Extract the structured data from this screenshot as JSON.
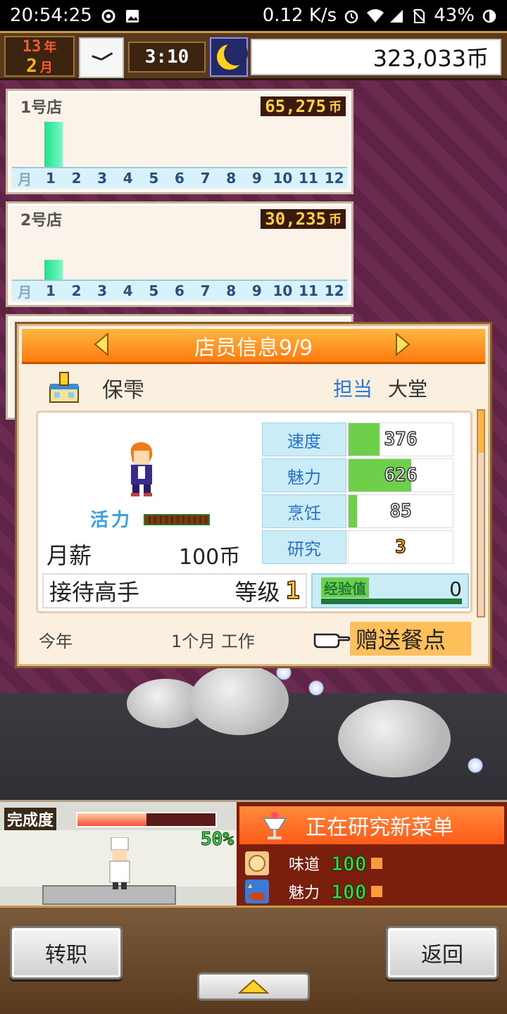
{
  "status_bar": {
    "time": "20:54:25",
    "network_speed": "0.12 K/s",
    "battery": "43%",
    "icons": [
      "swirl-icon",
      "image-icon",
      "alarm-icon",
      "wifi-icon",
      "signal-icon",
      "no-sim-icon",
      "battery-icon"
    ]
  },
  "hud": {
    "year_num": "13",
    "year_unit": "年",
    "month_num": "2",
    "month_unit": "月",
    "time": "3:10",
    "money": "323,033币"
  },
  "stores": [
    {
      "name": "1号店",
      "amount": "65,275",
      "currency_icon": "币",
      "bar_month": 1,
      "bar_fraction": 0.85
    },
    {
      "name": "2号店",
      "amount": "30,235",
      "currency_icon": "币",
      "bar_month": 1,
      "bar_fraction": 0.4
    }
  ],
  "chart_axis": {
    "month_label": "月",
    "months": [
      "1",
      "2",
      "3",
      "4",
      "5",
      "6",
      "7",
      "8",
      "9",
      "10",
      "11",
      "12"
    ]
  },
  "dialog": {
    "title": "店员信息9/9",
    "staff_name": "保雫",
    "role_label": "担当",
    "role_value": "大堂",
    "vitality_label": "活力",
    "vitality_fraction": 1.0,
    "salary_label": "月薪",
    "salary_value": "100币",
    "stats": [
      {
        "name": "速度",
        "value": "376",
        "fraction": 0.3
      },
      {
        "name": "魅力",
        "value": "626",
        "fraction": 0.6
      },
      {
        "name": "烹饪",
        "value": "85",
        "fraction": 0.08
      },
      {
        "name": "研究",
        "value": "3",
        "fraction": 0
      }
    ],
    "skill_name": "接待高手",
    "skill_level_label": "等级",
    "skill_level": "1",
    "exp_label": "经验值",
    "exp_value": "0",
    "year_label": "今年",
    "work_label": "1个月 工作",
    "gift_button": "赠送餐点"
  },
  "progress": {
    "label": "完成度",
    "percent_text": "50%",
    "fraction": 0.5
  },
  "research": {
    "title": "正在研究新菜单",
    "attributes": [
      {
        "name": "味道",
        "value": "100",
        "icon": "taste-icon"
      },
      {
        "name": "魅力",
        "value": "100",
        "icon": "charm-icon"
      }
    ]
  },
  "nav": {
    "transfer_button": "转职",
    "back_button": "返回"
  },
  "colors": {
    "accent_orange": "#ff7a0e",
    "stat_green": "#6ed04a",
    "stat_blue": "#c9ecf7",
    "bar_green": "#19e38f"
  }
}
